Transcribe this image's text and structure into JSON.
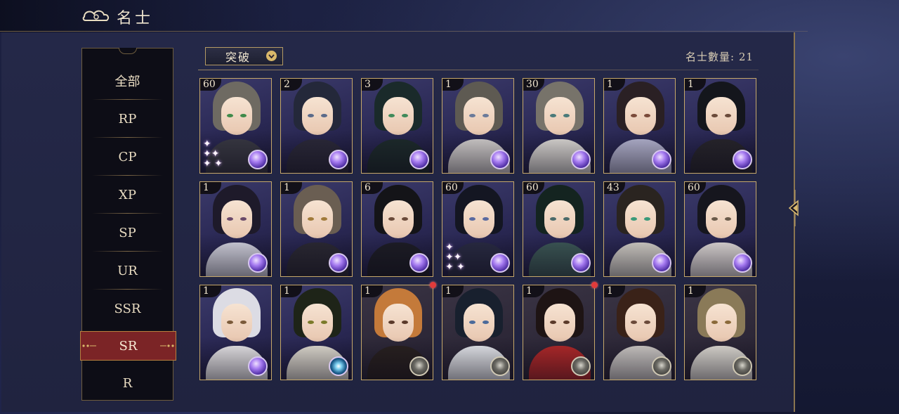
{
  "header": {
    "title": "名士"
  },
  "sidebar": {
    "items": [
      {
        "label": "全部"
      },
      {
        "label": "RP"
      },
      {
        "label": "CP"
      },
      {
        "label": "XP"
      },
      {
        "label": "SP"
      },
      {
        "label": "UR"
      },
      {
        "label": "SSR"
      },
      {
        "label": "SR"
      },
      {
        "label": "R"
      }
    ],
    "active": "SR"
  },
  "filter": {
    "label": "突破"
  },
  "count_text": "名士數量: 21",
  "cards": [
    {
      "level": "60",
      "orb": "purple",
      "hair": "#6e6a62",
      "robe": "#3a3a44",
      "eye": "#3f8a4a"
    },
    {
      "level": "2",
      "orb": "purple",
      "hair": "#24283a",
      "robe": "#2c2a3a",
      "eye": "#5a6a8a"
    },
    {
      "level": "3",
      "orb": "purple",
      "hair": "#1a2a2a",
      "robe": "#1e2c2c",
      "eye": "#3f8a5a"
    },
    {
      "level": "1",
      "orb": "purple",
      "hair": "#5e5a52",
      "robe": "#d8d4d2",
      "eye": "#6a7a9a"
    },
    {
      "level": "30",
      "orb": "purple",
      "hair": "#77736a",
      "robe": "#e2dfda",
      "eye": "#4a7a7a"
    },
    {
      "level": "1",
      "orb": "purple",
      "hair": "#2a2024",
      "robe": "#b8b8d4",
      "eye": "#7a4a3a"
    },
    {
      "level": "1",
      "orb": "purple",
      "hair": "#14161c",
      "robe": "#28262c",
      "eye": "#6a4a3a"
    },
    {
      "level": "1",
      "orb": "purple",
      "hair": "#1e1a2a",
      "robe": "#d8d8e4",
      "eye": "#6a4a6a"
    },
    {
      "level": "1",
      "orb": "purple",
      "hair": "#6a5e52",
      "robe": "#2c2a34",
      "eye": "#a07a3a"
    },
    {
      "level": "6",
      "orb": "purple",
      "hair": "#141418",
      "robe": "#1e1e26",
      "eye": "#6a4a3a"
    },
    {
      "level": "60",
      "orb": "purple",
      "hair": "#141622",
      "robe": "#2a2c44",
      "eye": "#5a6aa0"
    },
    {
      "level": "60",
      "orb": "purple",
      "hair": "#142420",
      "robe": "#3e5a58",
      "eye": "#4a6a6a"
    },
    {
      "level": "43",
      "orb": "purple",
      "hair": "#2a2420",
      "robe": "#d8d4cc",
      "eye": "#3a9a7a"
    },
    {
      "level": "60",
      "orb": "purple",
      "hair": "#16161e",
      "robe": "#e4dedc",
      "eye": "#6a5a4a"
    },
    {
      "level": "1",
      "orb": "purple",
      "hair": "#dcdce4",
      "robe": "#f0eef0",
      "eye": "#7a5a3a"
    },
    {
      "level": "1",
      "orb": "teal",
      "hair": "#1e2418",
      "robe": "#e8e4d8",
      "eye": "#7a7a2a"
    },
    {
      "level": "1",
      "orb": "gray",
      "hair": "#c47a3a",
      "robe": "#2a2220",
      "eye": "#5a3a2a"
    },
    {
      "level": "1",
      "orb": "gray",
      "hair": "#18202e",
      "robe": "#eef0f4",
      "eye": "#4a6a9a"
    },
    {
      "level": "1",
      "orb": "gray",
      "hair": "#1e1414",
      "robe": "#b82a2a",
      "eye": "#5a3a2a"
    },
    {
      "level": "1",
      "orb": "gray",
      "hair": "#3a2218",
      "robe": "#d4d0cc",
      "eye": "#6a4a3a"
    },
    {
      "level": "1",
      "orb": "gray",
      "hair": "#8a7a58",
      "robe": "#e6e2da",
      "eye": "#8a6a3a"
    }
  ],
  "badges": [
    16,
    18
  ],
  "sparkles": [
    0,
    10
  ],
  "colors": {
    "accent": "#c6a86a",
    "active_tab": "#7b2426",
    "badge": "#e23b3b"
  }
}
